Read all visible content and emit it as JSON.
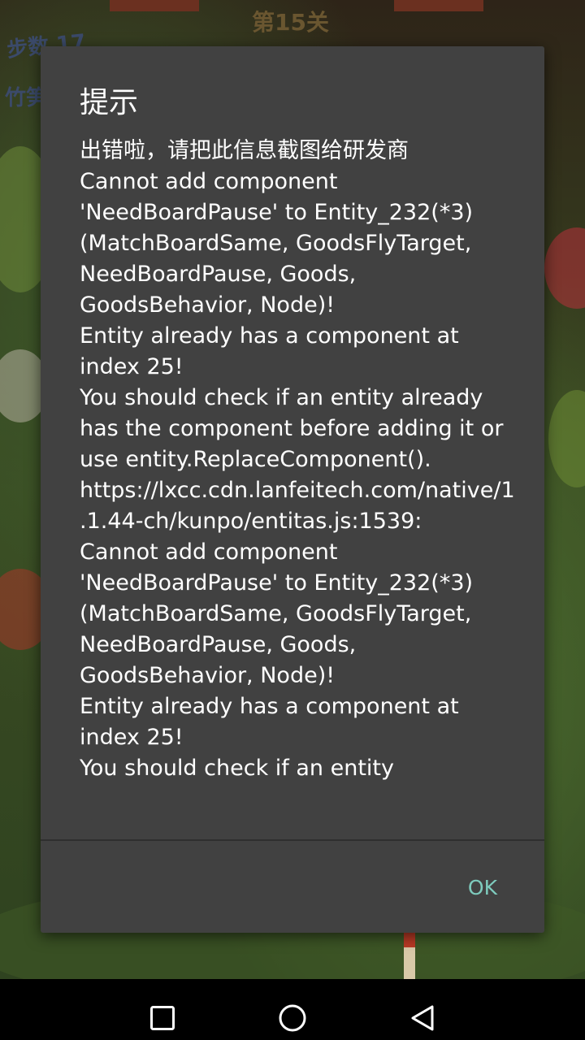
{
  "game": {
    "level_title": "第15关",
    "steps_label": "步数 17",
    "side_label": "竹笋"
  },
  "dialog": {
    "title": "提示",
    "message": "出错啦，请把此信息截图给研发商\nCannot add component 'NeedBoardPause' to Entity_232(*3)(MatchBoardSame, GoodsFlyTarget, NeedBoardPause, Goods, GoodsBehavior, Node)!\nEntity already has a component at index 25!\nYou should check if an entity already has the component before adding it or use entity.ReplaceComponent().\nhttps://lxcc.cdn.lanfeitech.com/native/1.1.44-ch/kunpo/entitas.js:1539:\nCannot add component 'NeedBoardPause' to Entity_232(*3)(MatchBoardSame, GoodsFlyTarget, NeedBoardPause, Goods, GoodsBehavior, Node)!\nEntity already has a component at index 25!\nYou should check if an entity",
    "ok_label": "OK",
    "accent_color": "#7ecbbd",
    "background_color": "#414141"
  },
  "navbar": {
    "recent_icon": "square-recent-apps-icon",
    "home_icon": "circle-home-icon",
    "back_icon": "triangle-back-icon"
  }
}
